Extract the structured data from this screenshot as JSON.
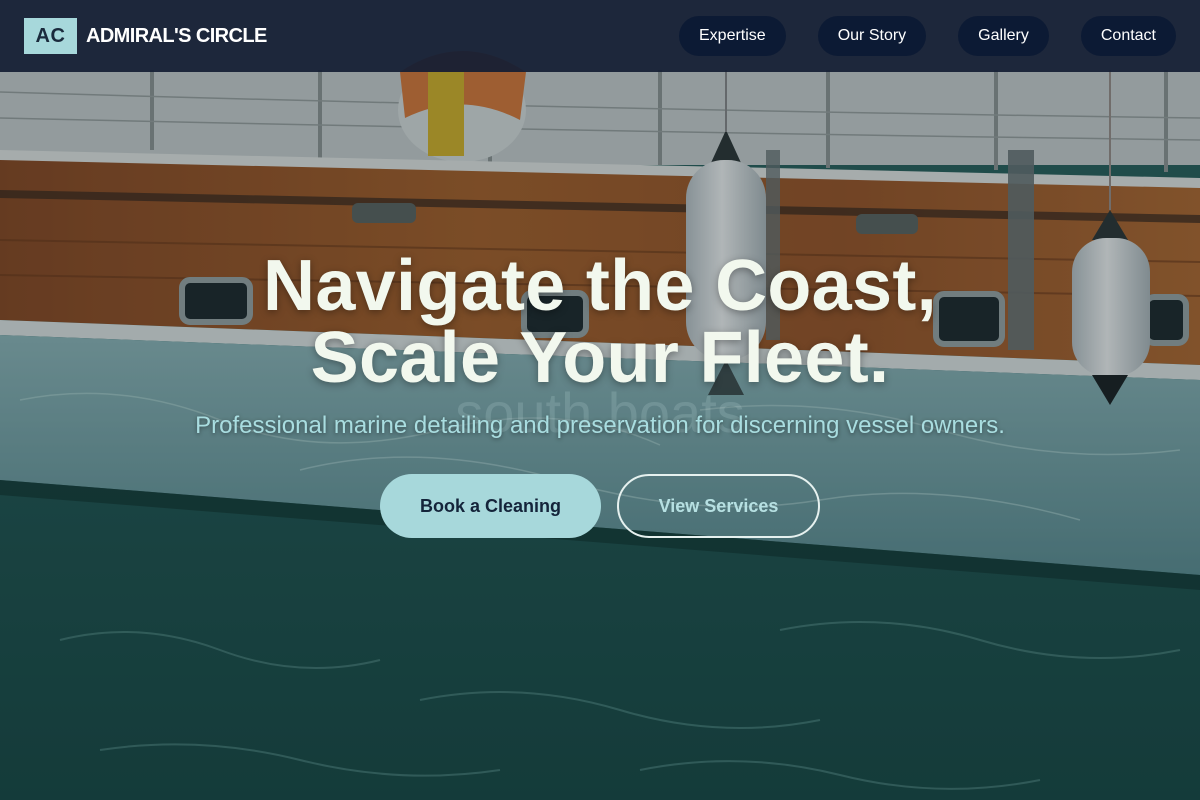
{
  "brand": {
    "initials": "AC",
    "name": "ADMIRAL'S CIRCLE"
  },
  "nav": {
    "items": [
      {
        "label": "Expertise"
      },
      {
        "label": "Our Story"
      },
      {
        "label": "Gallery"
      },
      {
        "label": "Contact"
      }
    ]
  },
  "hero": {
    "title_line1": "Navigate the Coast,",
    "title_line2": "Scale Your Fleet.",
    "subtitle": "Professional marine detailing and preservation for discerning vessel owners.",
    "background_watermark": "south boats",
    "primary_cta": "Book a Cleaning",
    "secondary_cta": "View Services"
  },
  "colors": {
    "accent": "#a7d8db",
    "navbar": "#141e34",
    "nav_pill": "#0c1a34",
    "title": "#f2f8ee",
    "subtitle": "#a9dde0",
    "water": "#235750"
  }
}
